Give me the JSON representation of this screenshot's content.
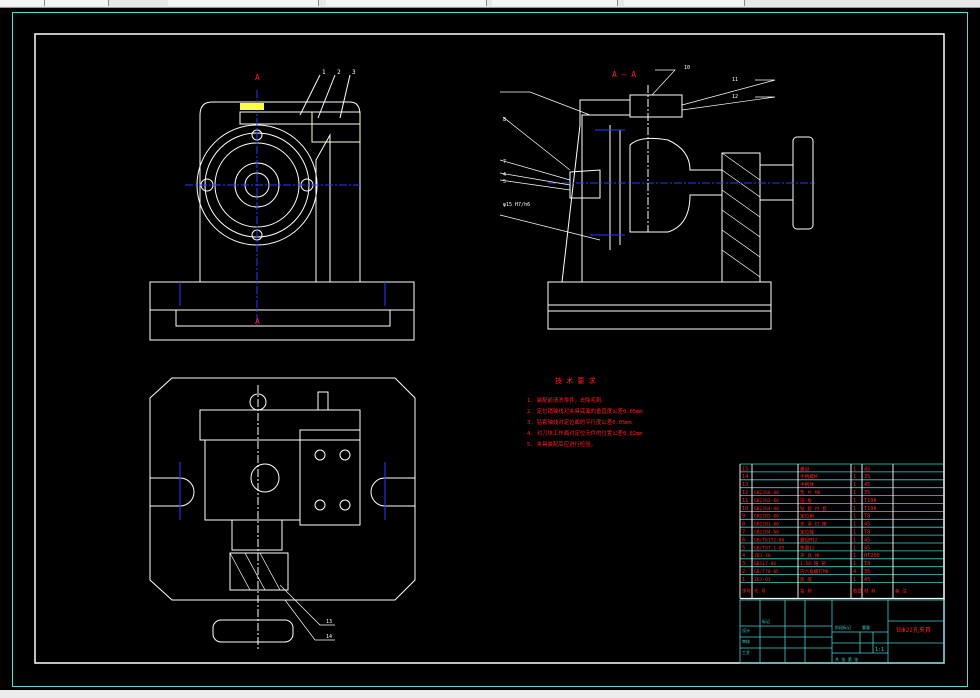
{
  "colors": {
    "background": "#000000",
    "frame": "#5fd7d7",
    "drawing": "#ffffff",
    "annotation": "#ff2020",
    "table": "#40d0d0",
    "centerline": "#2a3cff",
    "highlight": "#ffff40"
  },
  "views": {
    "front_section_mark": "A",
    "section_title": "A — A",
    "front_callouts": [
      "1",
      "2",
      "3"
    ],
    "side_callouts": [
      "10",
      "11",
      "12",
      "8",
      "7",
      "4",
      "5"
    ],
    "fit_label": "φ15 H7/h6",
    "bottom_callouts": [
      "13",
      "14"
    ]
  },
  "tech_requirements": {
    "title": "技 术 要 求",
    "items": [
      "1. 装配前清洗零件，去除毛刺。",
      "2. 定位销轴线对夹具底面的垂直度公差0.05mm",
      "3. 钻套轴线对定位面的平行度公差0.05mm",
      "4. 对刀块工作面对定位元件的位置公差0.02mm",
      "5. 夹具装配后应进行检验。"
    ]
  },
  "parts_list": {
    "rows": [
      {
        "no": "15",
        "code": "",
        "name": "螺母",
        "qty": "1",
        "material": "45"
      },
      {
        "no": "14",
        "code": "",
        "name": "手柄螺杆",
        "qty": "1",
        "material": "35"
      },
      {
        "no": "13",
        "code": "",
        "name": "手柄球",
        "qty": "1",
        "material": "45"
      },
      {
        "no": "12",
        "code": "GB2268-80",
        "name": "垫 片 M8",
        "qty": "1",
        "material": "35"
      },
      {
        "no": "11",
        "code": "GB2263-80",
        "name": "压 板",
        "qty": "1",
        "material": "T10A"
      },
      {
        "no": "10",
        "code": "GB2264-80",
        "name": "钻 套 衬 套",
        "qty": "1",
        "material": "T10A"
      },
      {
        "no": "9",
        "code": "GB2203-80",
        "name": "定位销",
        "qty": "1",
        "material": "T8"
      },
      {
        "no": "8",
        "code": "GB2201-80",
        "name": "支 承 钉 座",
        "qty": "1",
        "material": "45"
      },
      {
        "no": "7",
        "code": "GB2204-80",
        "name": "定位轴",
        "qty": "1",
        "material": "T8"
      },
      {
        "no": "6",
        "code": "GB/T6172-86",
        "name": "螺母M12",
        "qty": "1",
        "material": "45"
      },
      {
        "no": "5",
        "code": "GB/T97.1-85",
        "name": "垫圈12",
        "qty": "1",
        "material": "45"
      },
      {
        "no": "4",
        "code": "ZDJ-48",
        "name": "夹 具 体",
        "qty": "1",
        "material": "HT200"
      },
      {
        "no": "3",
        "code": "GB117-86",
        "name": "1:50 锥 销",
        "qty": "1",
        "material": "T8"
      },
      {
        "no": "2",
        "code": "GB/T70-85",
        "name": "内六角螺钉M8",
        "qty": "4",
        "material": "35"
      },
      {
        "no": "1",
        "code": "ZDJ-01",
        "name": "底 座",
        "qty": "1",
        "material": "45"
      }
    ],
    "header": {
      "no": "序号",
      "code": "代 号",
      "name": "名 称",
      "qty": "数量",
      "material": "材 料",
      "note": "备 注"
    }
  },
  "title_block": {
    "drawing_name": "钻Φ22孔夹具",
    "scale": "1:1",
    "sheet_label": "共 张 第 张",
    "left_labels": [
      "标记",
      "处数",
      "分区",
      "更改文件号",
      "签名",
      "年月日",
      "设计",
      "标准化",
      "审核",
      "工艺",
      "批准"
    ],
    "stage_label": "阶段标记",
    "weight_label": "重量",
    "scale_label": "比例"
  }
}
